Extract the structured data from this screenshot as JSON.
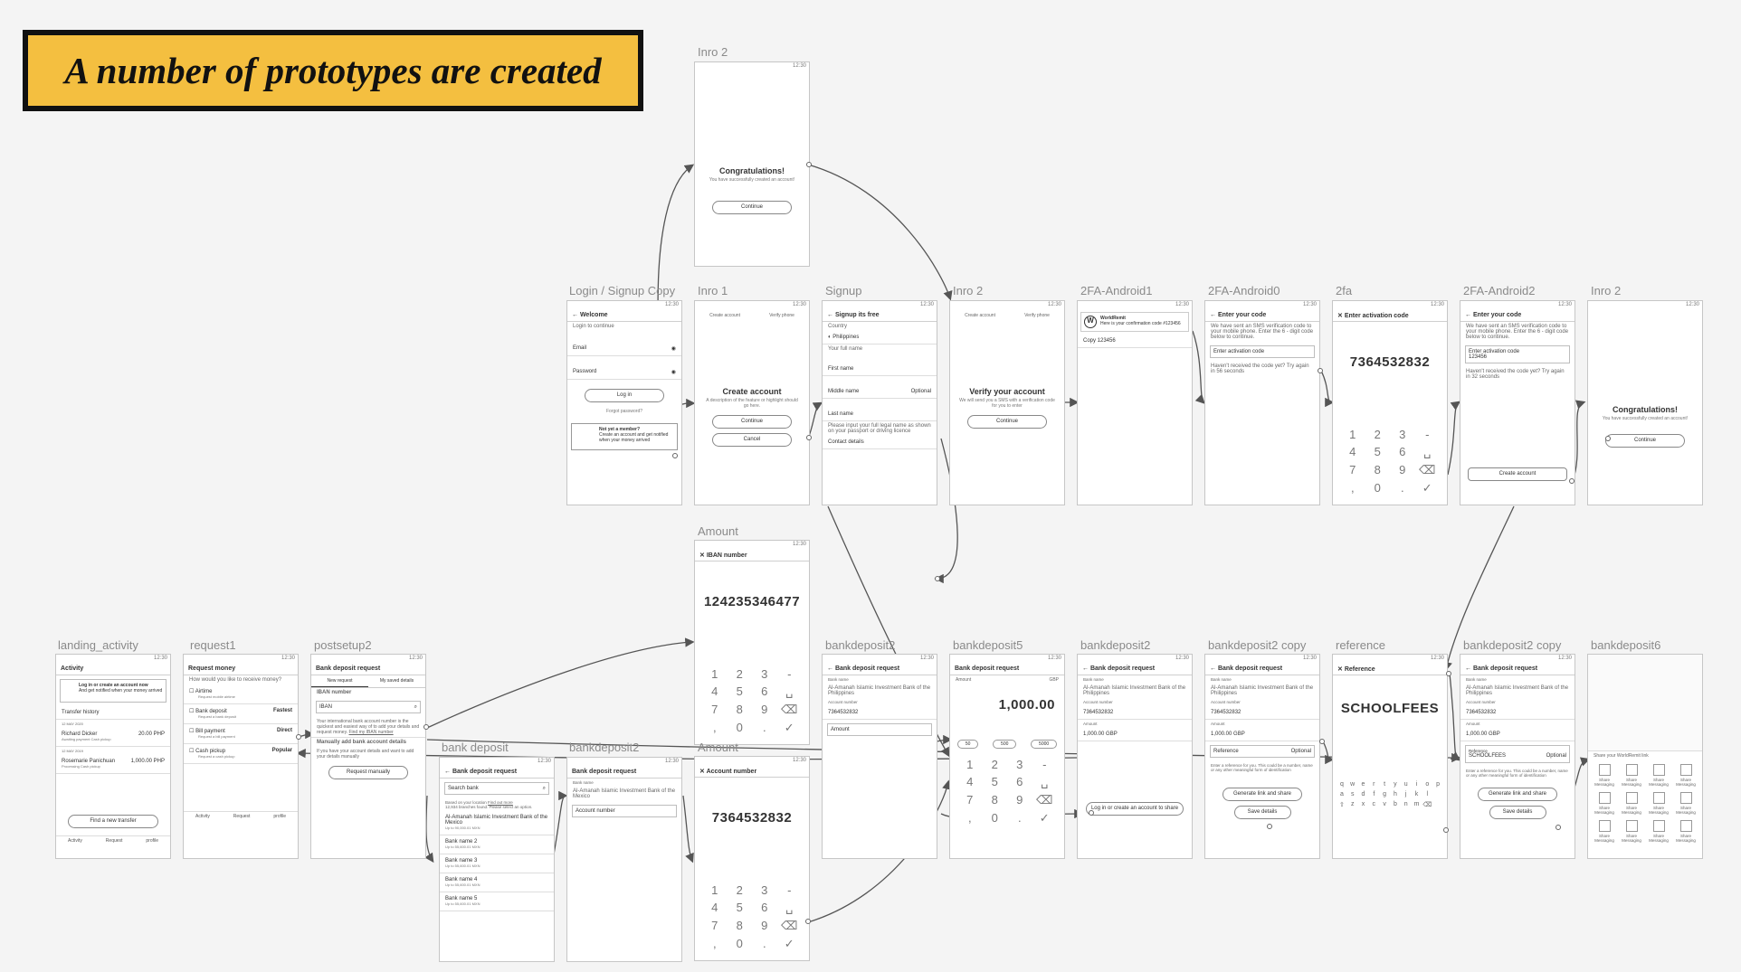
{
  "headline": "A number of prototypes are created",
  "status_time": "12:30",
  "frames": {
    "inro2_top": {
      "label": "Inro 2",
      "title": "Congratulations!",
      "sub": "You have successfully created an account!",
      "btn": "Continue"
    },
    "login": {
      "label": "Login / Signup Copy",
      "header": "Welcome",
      "sub": "Login to continue",
      "email": "Email",
      "password": "Password",
      "login_btn": "Log in",
      "forgot": "Forgot password?",
      "member_q": "Not yet a member?",
      "member_sub": "Create an account and get notified when your money arrived"
    },
    "intro1": {
      "label": "Inro 1",
      "step1": "Create account",
      "step2": "Verify phone",
      "title": "Create account",
      "sub": "A description of the feature or highlight should go here.",
      "btn1": "Continue",
      "btn2": "Cancel"
    },
    "signup": {
      "label": "Signup",
      "header": "Signup its free",
      "country": "Country",
      "country_val": "Philippines",
      "full_name": "Your full name",
      "first": "First name",
      "middle": "Middle name",
      "optional": "Optional",
      "last": "Last name",
      "note": "Please input your full legal name as shown on your passport or driving licence",
      "contact": "Contact details"
    },
    "inro2_mid": {
      "label": "Inro 2",
      "step1": "Create account",
      "step2": "Verify phone",
      "title": "Verify your account",
      "sub": "We will send you a SMS with a verification code for you to enter",
      "btn": "Continue"
    },
    "fa1": {
      "label": "2FA-Android1",
      "brand": "WorldRemit",
      "msg": "Here is your confirmation code #123456",
      "copy": "Copy 123456"
    },
    "fa0": {
      "label": "2FA-Android0",
      "header": "Enter your code",
      "sub": "We have sent an SMS verification code to your mobile phone. Enter the 6 - digit code below to continue.",
      "field": "Enter activation code",
      "resend": "Haven't received the code yet? Try again in 56 seconds"
    },
    "twofa": {
      "label": "2fa",
      "header": "Enter activation code",
      "code": "7364532832"
    },
    "fa2": {
      "label": "2FA-Android2",
      "header": "Enter your code",
      "sub": "We have sent an SMS verification code to your mobile phone. Enter the 6 - digit code below to continue.",
      "field_lbl": "Enter activation code",
      "field_val": "123456",
      "resend": "Haven't received the code yet? Try again in 32 seconds",
      "btn": "Create account"
    },
    "inro2_right": {
      "label": "Inro 2",
      "title": "Congratulations!",
      "sub": "You have successfully created an account!",
      "btn": "Continue"
    },
    "amount1": {
      "label": "Amount",
      "header": "IBAN number",
      "value": "124235346477"
    },
    "amount2": {
      "label": "Amount",
      "header": "Account number",
      "value": "7364532832"
    },
    "landing": {
      "label": "landing_activity",
      "header": "Activity",
      "banner": "Log in or create an account now",
      "banner_sub": "And get notified when your money arrived",
      "history": "Transfer history",
      "date1": "12 MAY 2020",
      "p1": "Richard Dicker",
      "p1_sub": "Awaiting payment Cash pickup",
      "p1_amt": "20.00 PHP",
      "date2": "12 MAY 2019",
      "p2": "Rosemarie Panichuan",
      "p2_sub": "Processing Cash pickup",
      "p2_amt": "1,000.00 PHP",
      "btn": "Find a new transfer",
      "tab1": "Activity",
      "tab2": "Request",
      "tab3": "profile"
    },
    "request1": {
      "label": "request1",
      "header": "Request money",
      "q": "How would you like to receive money?",
      "o1": "Airtime",
      "o1s": "Request mobile airtime",
      "o2": "Bank deposit",
      "o2s": "Request a bank deposit",
      "o2t": "Fastest",
      "o3": "Bill payment",
      "o3s": "Request a bill payment",
      "o3t": "Direct",
      "o4": "Cash pickup",
      "o4s": "Request a cash pickup",
      "o4t": "Popular",
      "tab1": "Activity",
      "tab2": "Request",
      "tab3": "profile"
    },
    "postsetup2": {
      "label": "postsetup2",
      "header": "Bank deposit request",
      "tab1": "New request",
      "tab2": "My saved details",
      "iban_lbl": "IBAN number",
      "iban": "IBAN",
      "note": "Your international bank account number is the quickest and easiest way of to add your details and request money.",
      "find": "Find my IBAN number",
      "manual": "Manually add bank account details",
      "manual_sub": "If you have your account details and want to add your details manually",
      "btn": "Request manually"
    },
    "bankdeposit": {
      "label": "bank deposit",
      "header": "Bank deposit request",
      "search": "Search bank",
      "note": "Based on your location",
      "find": "Find out more",
      "found": "12,934 branches found. Please select an option.",
      "b1": "Al-Amanah Islamic Investment Bank of the Mexico",
      "b1s": "Up to 90,000.01 MXN",
      "b2": "Bank name 2",
      "b2s": "Up to 55,600.01 MXN",
      "b3": "Bank name 3",
      "b3s": "Up to 55,600.01 MXN",
      "b4": "Bank name 4",
      "b4s": "Up to 55,600.01 MXN",
      "b5": "Bank name 5",
      "b5s": "Up to 55,600.01 MXN"
    },
    "bd2_small": {
      "label": "bankdeposit2",
      "header": "Bank deposit request",
      "bank_lbl": "Bank name",
      "bank": "Al-Amanah Islamic Investment Bank of the Mexico",
      "acc": "Account number"
    },
    "bd2_a": {
      "label": "bankdeposit2",
      "header": "Bank deposit request",
      "bank_lbl": "Bank name",
      "bank": "Al-Amanah Islamic Investment Bank of the Philippines",
      "acc_lbl": "Account number",
      "acc": "7364532832",
      "amount": "Amount"
    },
    "bd5": {
      "label": "bankdeposit5",
      "header": "Bank deposit request",
      "amount_lbl": "Amount",
      "ccy": "GBP",
      "value": "1,000.00",
      "q1": "50",
      "q2": "500",
      "q3": "5000"
    },
    "bd2_b": {
      "label": "bankdeposit2",
      "header": "Bank deposit request",
      "bank_lbl": "Bank name",
      "bank": "Al-Amanah Islamic Investment Bank of the Philippines",
      "acc_lbl": "Account number",
      "acc": "7364532832",
      "amt_lbl": "Amount",
      "amt": "1,000.00 GBP",
      "btn": "Log in or create an account to share"
    },
    "bd2_copy": {
      "label": "bankdeposit2 copy",
      "header": "Bank deposit request",
      "bank_lbl": "Bank name",
      "bank": "Al-Amanah Islamic Investment Bank of the Philippines",
      "acc_lbl": "Account number",
      "acc": "7364532832",
      "amt_lbl": "Amount",
      "amt": "1,000.00 GBP",
      "ref": "Reference",
      "optional": "Optional",
      "ref_note": "Enter a reference for you. This could be a number, name or any other meaningful form of identification",
      "btn1": "Generate link and share",
      "btn2": "Save details"
    },
    "reference": {
      "label": "reference",
      "header": "Reference",
      "value": "SCHOOLFEES"
    },
    "bd2_copy2": {
      "label": "bankdeposit2 copy",
      "header": "Bank deposit request",
      "bank_lbl": "Bank name",
      "bank": "Al-Amanah Islamic Investment Bank of the Philippines",
      "acc_lbl": "Account number",
      "acc": "7364532832",
      "amt_lbl": "Amount",
      "amt": "1,000.00 GBP",
      "ref_lbl": "Reference",
      "ref": "SCHOOLFEES",
      "optional": "Optional",
      "ref_note": "Enter a reference for you. This could be a number, name or any other meaningful form of identification",
      "btn1": "Generate link and share",
      "btn2": "Save details"
    },
    "bd6": {
      "label": "bankdeposit6",
      "share_head": "Share your WorldRemit link",
      "share": "Share",
      "msg": "Messaging"
    }
  },
  "keypad": [
    "1",
    "2",
    "3",
    "-",
    "4",
    "5",
    "6",
    "␣",
    "7",
    "8",
    "9",
    "⌫",
    ",",
    "0",
    ".",
    "✓"
  ],
  "keyboard": [
    "q",
    "w",
    "e",
    "r",
    "t",
    "y",
    "u",
    "i",
    "o",
    "p",
    "a",
    "s",
    "d",
    "f",
    "g",
    "h",
    "j",
    "k",
    "l",
    "",
    "⇧",
    "z",
    "x",
    "c",
    "v",
    "b",
    "n",
    "m",
    "⌫",
    ""
  ]
}
